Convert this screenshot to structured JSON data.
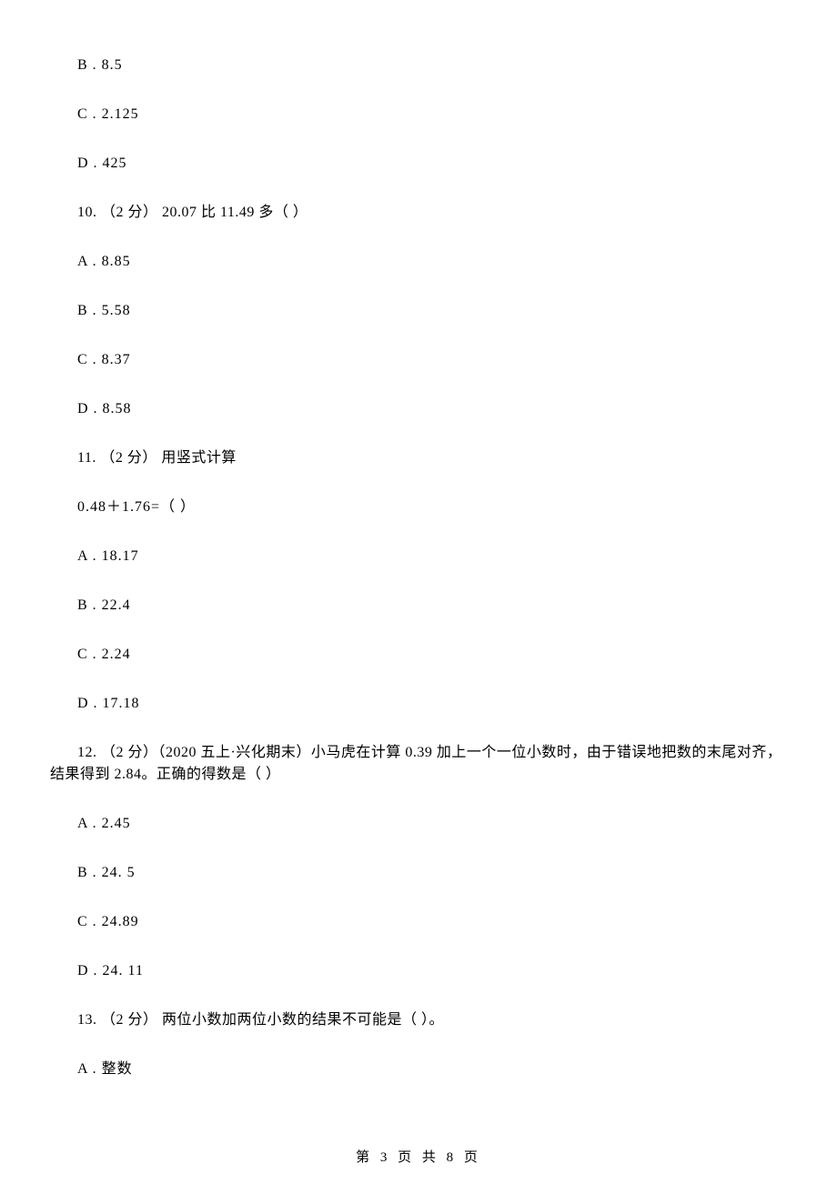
{
  "pre_options": [
    "B . 8.5",
    "C . 2.125",
    "D . 425"
  ],
  "q10": {
    "stem": "10. （2 分） 20.07 比 11.49 多（    ）",
    "options": [
      "A . 8.85",
      "B . 5.58",
      "C . 8.37",
      "D . 8.58"
    ]
  },
  "q11": {
    "stem": "11. （2 分） 用竖式计算",
    "sub": "0.48＋1.76=（    ）",
    "options": [
      "A . 18.17",
      "B . 22.4",
      "C . 2.24",
      "D . 17.18"
    ]
  },
  "q12": {
    "stem": "12. （2 分）（2020 五上·兴化期末）小马虎在计算 0.39 加上一个一位小数时，由于错误地把数的末尾对齐，结果得到 2.84。正确的得数是（    ）",
    "options": [
      "A . 2.45",
      "B . 24. 5",
      "C . 24.89",
      "D . 24. 11"
    ]
  },
  "q13": {
    "stem": "13. （2 分） 两位小数加两位小数的结果不可能是（    ）。",
    "options": [
      "A . 整数"
    ]
  },
  "footer": "第 3 页 共 8 页"
}
